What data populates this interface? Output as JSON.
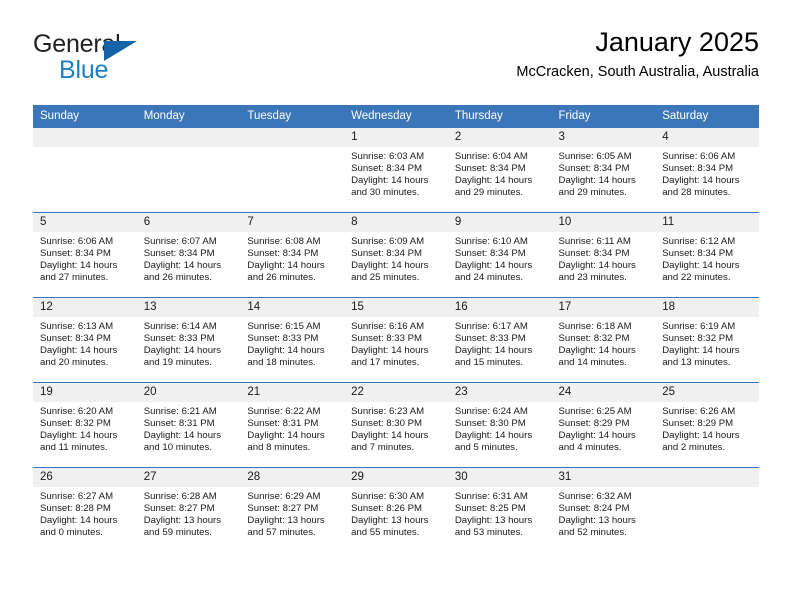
{
  "logo": {
    "text_top": "General",
    "text_bottom": "Blue",
    "triangle_color": "#1263a8",
    "blue_color": "#1d7fc3"
  },
  "header": {
    "title": "January 2025",
    "subtitle": "McCracken, South Australia, Australia"
  },
  "theme": {
    "header_bar_color": "#3b77b8",
    "daynum_band_color": "#f0f0f0",
    "row_separator_color": "#3b77b8"
  },
  "weekday_headers": [
    "Sunday",
    "Monday",
    "Tuesday",
    "Wednesday",
    "Thursday",
    "Friday",
    "Saturday"
  ],
  "weeks": [
    [
      {
        "day": "",
        "sunrise": "",
        "sunset": "",
        "daylight_1": "",
        "daylight_2": ""
      },
      {
        "day": "",
        "sunrise": "",
        "sunset": "",
        "daylight_1": "",
        "daylight_2": ""
      },
      {
        "day": "",
        "sunrise": "",
        "sunset": "",
        "daylight_1": "",
        "daylight_2": ""
      },
      {
        "day": "1",
        "sunrise": "Sunrise: 6:03 AM",
        "sunset": "Sunset: 8:34 PM",
        "daylight_1": "Daylight: 14 hours",
        "daylight_2": "and 30 minutes."
      },
      {
        "day": "2",
        "sunrise": "Sunrise: 6:04 AM",
        "sunset": "Sunset: 8:34 PM",
        "daylight_1": "Daylight: 14 hours",
        "daylight_2": "and 29 minutes."
      },
      {
        "day": "3",
        "sunrise": "Sunrise: 6:05 AM",
        "sunset": "Sunset: 8:34 PM",
        "daylight_1": "Daylight: 14 hours",
        "daylight_2": "and 29 minutes."
      },
      {
        "day": "4",
        "sunrise": "Sunrise: 6:06 AM",
        "sunset": "Sunset: 8:34 PM",
        "daylight_1": "Daylight: 14 hours",
        "daylight_2": "and 28 minutes."
      }
    ],
    [
      {
        "day": "5",
        "sunrise": "Sunrise: 6:06 AM",
        "sunset": "Sunset: 8:34 PM",
        "daylight_1": "Daylight: 14 hours",
        "daylight_2": "and 27 minutes."
      },
      {
        "day": "6",
        "sunrise": "Sunrise: 6:07 AM",
        "sunset": "Sunset: 8:34 PM",
        "daylight_1": "Daylight: 14 hours",
        "daylight_2": "and 26 minutes."
      },
      {
        "day": "7",
        "sunrise": "Sunrise: 6:08 AM",
        "sunset": "Sunset: 8:34 PM",
        "daylight_1": "Daylight: 14 hours",
        "daylight_2": "and 26 minutes."
      },
      {
        "day": "8",
        "sunrise": "Sunrise: 6:09 AM",
        "sunset": "Sunset: 8:34 PM",
        "daylight_1": "Daylight: 14 hours",
        "daylight_2": "and 25 minutes."
      },
      {
        "day": "9",
        "sunrise": "Sunrise: 6:10 AM",
        "sunset": "Sunset: 8:34 PM",
        "daylight_1": "Daylight: 14 hours",
        "daylight_2": "and 24 minutes."
      },
      {
        "day": "10",
        "sunrise": "Sunrise: 6:11 AM",
        "sunset": "Sunset: 8:34 PM",
        "daylight_1": "Daylight: 14 hours",
        "daylight_2": "and 23 minutes."
      },
      {
        "day": "11",
        "sunrise": "Sunrise: 6:12 AM",
        "sunset": "Sunset: 8:34 PM",
        "daylight_1": "Daylight: 14 hours",
        "daylight_2": "and 22 minutes."
      }
    ],
    [
      {
        "day": "12",
        "sunrise": "Sunrise: 6:13 AM",
        "sunset": "Sunset: 8:34 PM",
        "daylight_1": "Daylight: 14 hours",
        "daylight_2": "and 20 minutes."
      },
      {
        "day": "13",
        "sunrise": "Sunrise: 6:14 AM",
        "sunset": "Sunset: 8:33 PM",
        "daylight_1": "Daylight: 14 hours",
        "daylight_2": "and 19 minutes."
      },
      {
        "day": "14",
        "sunrise": "Sunrise: 6:15 AM",
        "sunset": "Sunset: 8:33 PM",
        "daylight_1": "Daylight: 14 hours",
        "daylight_2": "and 18 minutes."
      },
      {
        "day": "15",
        "sunrise": "Sunrise: 6:16 AM",
        "sunset": "Sunset: 8:33 PM",
        "daylight_1": "Daylight: 14 hours",
        "daylight_2": "and 17 minutes."
      },
      {
        "day": "16",
        "sunrise": "Sunrise: 6:17 AM",
        "sunset": "Sunset: 8:33 PM",
        "daylight_1": "Daylight: 14 hours",
        "daylight_2": "and 15 minutes."
      },
      {
        "day": "17",
        "sunrise": "Sunrise: 6:18 AM",
        "sunset": "Sunset: 8:32 PM",
        "daylight_1": "Daylight: 14 hours",
        "daylight_2": "and 14 minutes."
      },
      {
        "day": "18",
        "sunrise": "Sunrise: 6:19 AM",
        "sunset": "Sunset: 8:32 PM",
        "daylight_1": "Daylight: 14 hours",
        "daylight_2": "and 13 minutes."
      }
    ],
    [
      {
        "day": "19",
        "sunrise": "Sunrise: 6:20 AM",
        "sunset": "Sunset: 8:32 PM",
        "daylight_1": "Daylight: 14 hours",
        "daylight_2": "and 11 minutes."
      },
      {
        "day": "20",
        "sunrise": "Sunrise: 6:21 AM",
        "sunset": "Sunset: 8:31 PM",
        "daylight_1": "Daylight: 14 hours",
        "daylight_2": "and 10 minutes."
      },
      {
        "day": "21",
        "sunrise": "Sunrise: 6:22 AM",
        "sunset": "Sunset: 8:31 PM",
        "daylight_1": "Daylight: 14 hours",
        "daylight_2": "and 8 minutes."
      },
      {
        "day": "22",
        "sunrise": "Sunrise: 6:23 AM",
        "sunset": "Sunset: 8:30 PM",
        "daylight_1": "Daylight: 14 hours",
        "daylight_2": "and 7 minutes."
      },
      {
        "day": "23",
        "sunrise": "Sunrise: 6:24 AM",
        "sunset": "Sunset: 8:30 PM",
        "daylight_1": "Daylight: 14 hours",
        "daylight_2": "and 5 minutes."
      },
      {
        "day": "24",
        "sunrise": "Sunrise: 6:25 AM",
        "sunset": "Sunset: 8:29 PM",
        "daylight_1": "Daylight: 14 hours",
        "daylight_2": "and 4 minutes."
      },
      {
        "day": "25",
        "sunrise": "Sunrise: 6:26 AM",
        "sunset": "Sunset: 8:29 PM",
        "daylight_1": "Daylight: 14 hours",
        "daylight_2": "and 2 minutes."
      }
    ],
    [
      {
        "day": "26",
        "sunrise": "Sunrise: 6:27 AM",
        "sunset": "Sunset: 8:28 PM",
        "daylight_1": "Daylight: 14 hours",
        "daylight_2": "and 0 minutes."
      },
      {
        "day": "27",
        "sunrise": "Sunrise: 6:28 AM",
        "sunset": "Sunset: 8:27 PM",
        "daylight_1": "Daylight: 13 hours",
        "daylight_2": "and 59 minutes."
      },
      {
        "day": "28",
        "sunrise": "Sunrise: 6:29 AM",
        "sunset": "Sunset: 8:27 PM",
        "daylight_1": "Daylight: 13 hours",
        "daylight_2": "and 57 minutes."
      },
      {
        "day": "29",
        "sunrise": "Sunrise: 6:30 AM",
        "sunset": "Sunset: 8:26 PM",
        "daylight_1": "Daylight: 13 hours",
        "daylight_2": "and 55 minutes."
      },
      {
        "day": "30",
        "sunrise": "Sunrise: 6:31 AM",
        "sunset": "Sunset: 8:25 PM",
        "daylight_1": "Daylight: 13 hours",
        "daylight_2": "and 53 minutes."
      },
      {
        "day": "31",
        "sunrise": "Sunrise: 6:32 AM",
        "sunset": "Sunset: 8:24 PM",
        "daylight_1": "Daylight: 13 hours",
        "daylight_2": "and 52 minutes."
      },
      {
        "day": "",
        "sunrise": "",
        "sunset": "",
        "daylight_1": "",
        "daylight_2": ""
      }
    ]
  ]
}
